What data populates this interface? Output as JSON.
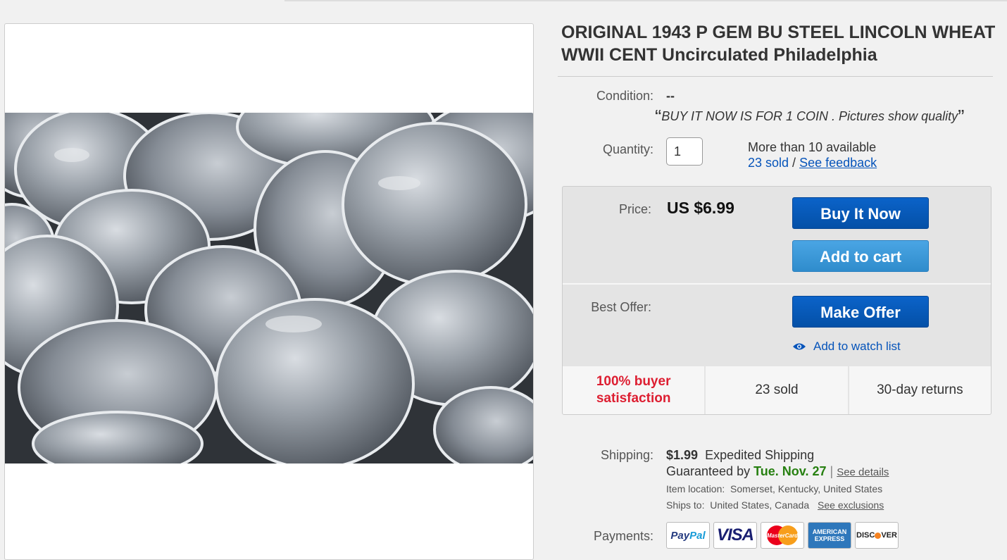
{
  "listing": {
    "title": "ORIGINAL 1943 P GEM BU STEEL LINCOLN WHEAT WWII CENT Uncirculated Philadelphia"
  },
  "condition": {
    "label": "Condition:",
    "value": "--",
    "note": "BUY IT NOW IS FOR 1 COIN . Pictures show quality",
    "open_quote": "“",
    "close_quote": "”"
  },
  "quantity": {
    "label": "Quantity:",
    "value": "1",
    "available": "More than 10 available",
    "sold_link": "23 sold",
    "separator": " / ",
    "feedback_link": "See feedback"
  },
  "buybox": {
    "price_label": "Price:",
    "price": "US $6.99",
    "buy_now": "Buy It Now",
    "add_to_cart": "Add to cart",
    "best_offer_label": "Best Offer:",
    "make_offer": "Make Offer",
    "watch": "Add to watch list",
    "stats": {
      "satisfaction_line1": "100% buyer",
      "satisfaction_line2": "satisfaction",
      "sold": "23 sold",
      "returns": "30-day returns"
    }
  },
  "shipping": {
    "label": "Shipping:",
    "cost": "$1.99",
    "method": "Expedited Shipping",
    "guaranteed_prefix": "Guaranteed by",
    "guaranteed_date": "Tue. Nov. 27",
    "pipe": "|",
    "details_link": "See details",
    "location_label": "Item location:",
    "location": "Somerset, Kentucky, United States",
    "ships_to_label": "Ships to:",
    "ships_to": "United States, Canada",
    "exclusions_link": "See exclusions"
  },
  "payments": {
    "label": "Payments:",
    "paypal_a": "Pay",
    "paypal_b": "Pal",
    "visa": "VISA",
    "mastercard": "MasterCard",
    "amex_1": "AMERICAN",
    "amex_2": "EXPRESS",
    "discover_a": "DISC",
    "discover_b": "VER"
  },
  "colors": {
    "link": "#0654ba",
    "buy_button": "#0654ba",
    "cart_button": "#3a96d8",
    "satisfaction": "#dd1e31",
    "guarantee": "#278011"
  }
}
